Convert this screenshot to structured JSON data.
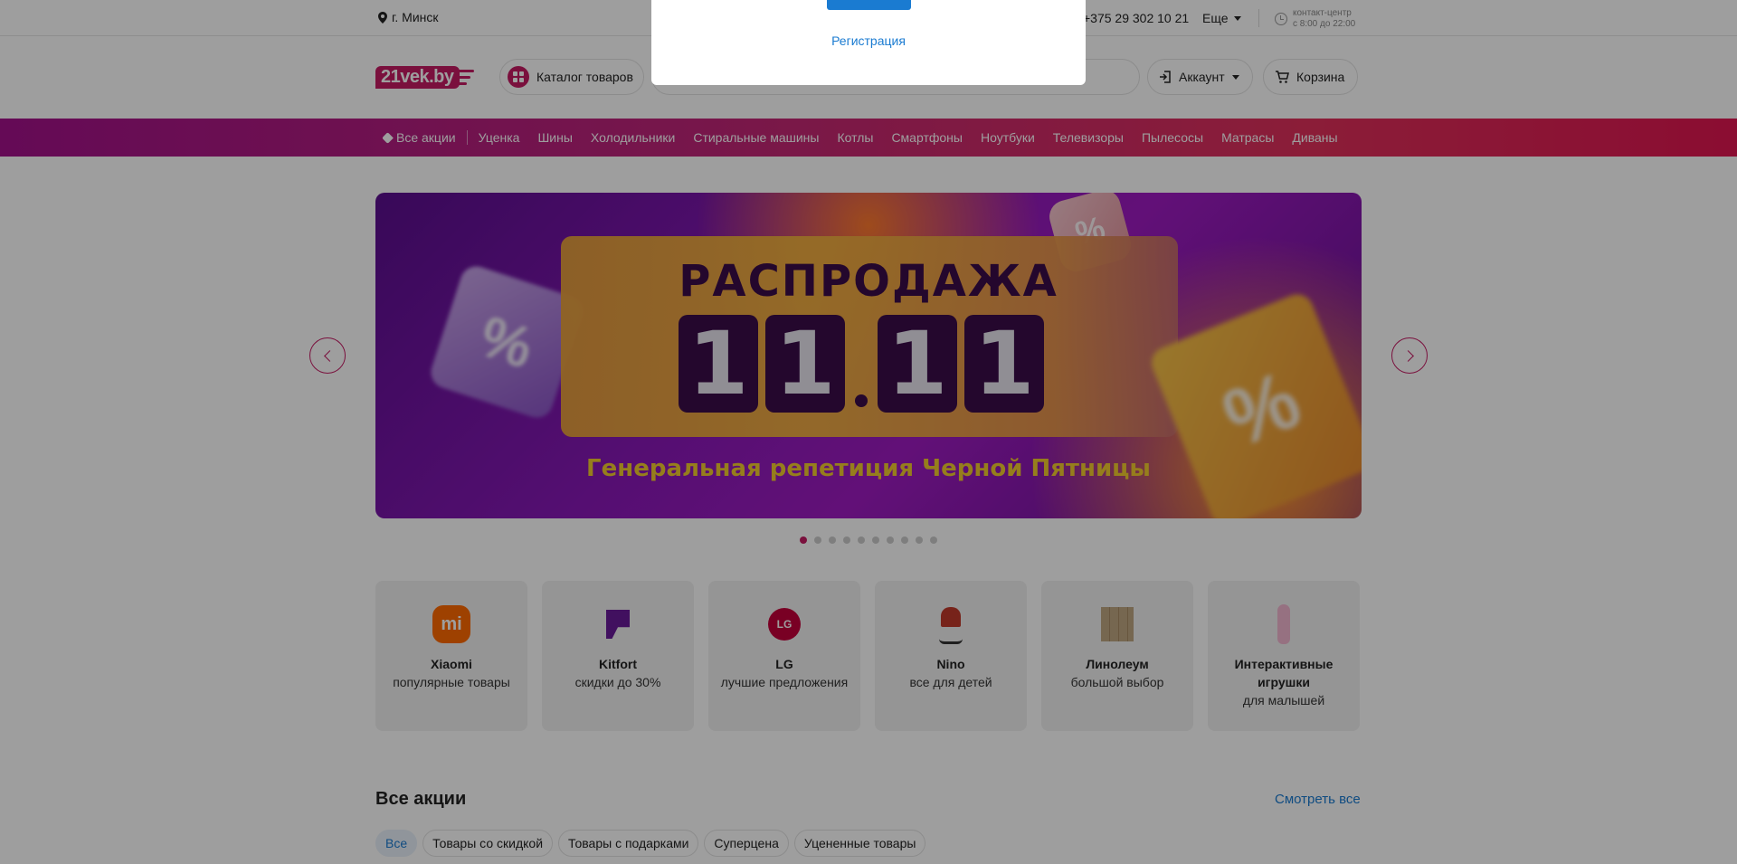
{
  "topbar": {
    "city": "г. Минск",
    "phone": "+375 29 302 10 21",
    "more_label": "Еще",
    "hours_line1": "контакт-центр",
    "hours_line2": "с 8:00 до 22:00"
  },
  "header": {
    "logo_text": "21vek.by",
    "catalog_label": "Каталог товаров",
    "account_label": "Аккаунт",
    "cart_label": "Корзина"
  },
  "nav": {
    "items": [
      "Все акции",
      "Уценка",
      "Шины",
      "Холодильники",
      "Стиральные машины",
      "Котлы",
      "Смартфоны",
      "Ноутбуки",
      "Телевизоры",
      "Пылесосы",
      "Матрасы",
      "Диваны"
    ]
  },
  "banner": {
    "title": "РАСПРОДАЖА",
    "digits": [
      "1",
      "1",
      "1",
      "1"
    ],
    "subtitle": "Генеральная репетиция Черной Пятницы",
    "percent_symbol": "%",
    "slide_count": 10,
    "active_slide": 0
  },
  "promos": [
    {
      "title": "Xiaomi",
      "subtitle": "популярные товары",
      "icon": "xiaomi-logo-icon",
      "mark": "mi"
    },
    {
      "title": "Kitfort",
      "subtitle": "скидки до 30%",
      "icon": "kitfort-logo-icon"
    },
    {
      "title": "LG",
      "subtitle": "лучшие предложения",
      "icon": "lg-logo-icon",
      "mark": "LG"
    },
    {
      "title": "Nino",
      "subtitle": "все для детей",
      "icon": "stroller-icon"
    },
    {
      "title": "Линолеум",
      "subtitle": "большой выбор",
      "icon": "linoleum-icon"
    },
    {
      "title": "Интерактивные игрушки",
      "subtitle": "для малышей",
      "icon": "toy-icon"
    }
  ],
  "deals": {
    "title": "Все акции",
    "see_all": "Смотреть все",
    "chips": [
      "Все",
      "Товары со скидкой",
      "Товары с подарками",
      "Суперцена",
      "Уцененные товары"
    ]
  },
  "modal": {
    "register_link": "Регистрация"
  },
  "colors": {
    "brand": "#c51a63",
    "link": "#1a7bd1",
    "overlay": "rgba(0,0,0,0.38)"
  }
}
